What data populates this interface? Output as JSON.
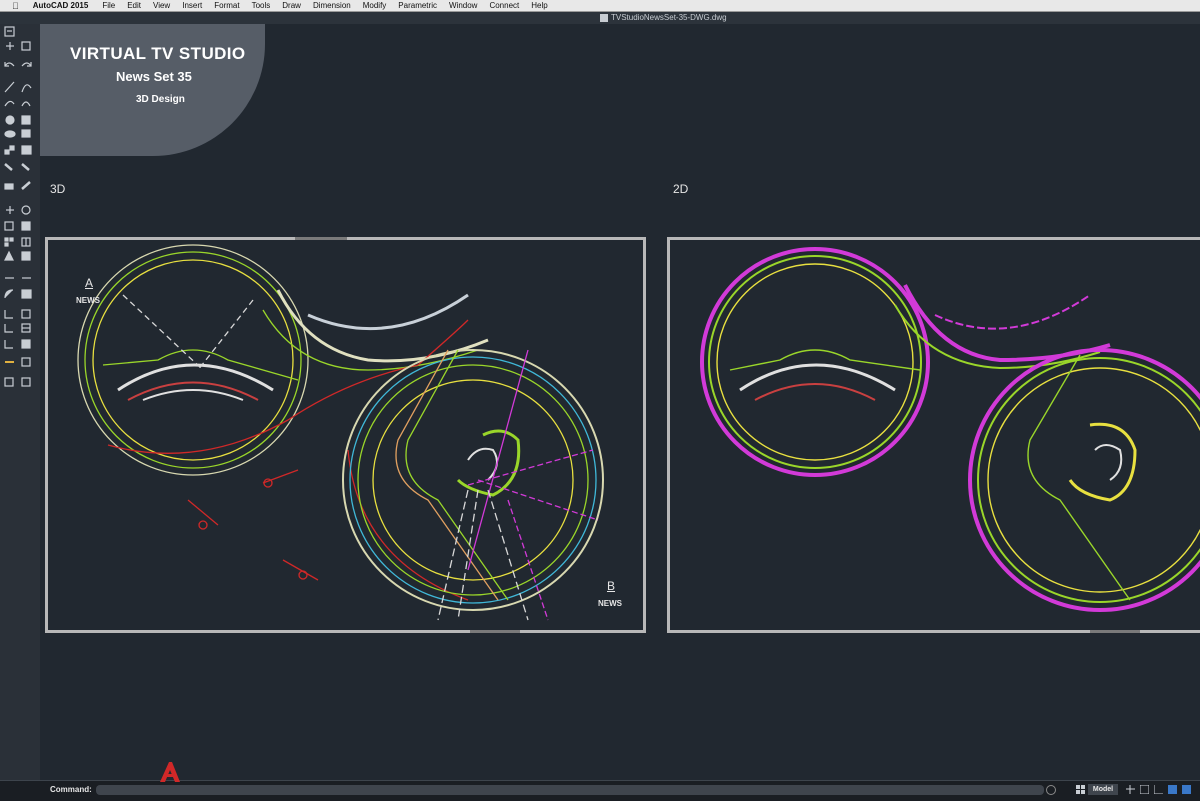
{
  "app": {
    "name": "AutoCAD 2015"
  },
  "menu": [
    "File",
    "Edit",
    "View",
    "Insert",
    "Format",
    "Tools",
    "Draw",
    "Dimension",
    "Modify",
    "Parametric",
    "Window",
    "Connect",
    "Help"
  ],
  "document": {
    "title": "TVStudioNewsSet-35-DWG.dwg"
  },
  "overlay": {
    "title": "VIRTUAL TV STUDIO",
    "subtitle": "News Set 35",
    "tagline": "3D Design"
  },
  "views": [
    {
      "label": "3D",
      "markers": [
        {
          "letter": "A",
          "text": "NEWS"
        },
        {
          "letter": "B",
          "text": "NEWS"
        }
      ]
    },
    {
      "label": "2D"
    }
  ],
  "statusbar": {
    "command_label": "Command:",
    "model_tab": "Model"
  },
  "colors": {
    "background": "#212830",
    "viewport_border": "#b8b8b8",
    "red": "#d02828",
    "green": "#9ad62a",
    "yellow": "#e8e040",
    "magenta": "#d23ad8",
    "cyan": "#40b8d8"
  }
}
